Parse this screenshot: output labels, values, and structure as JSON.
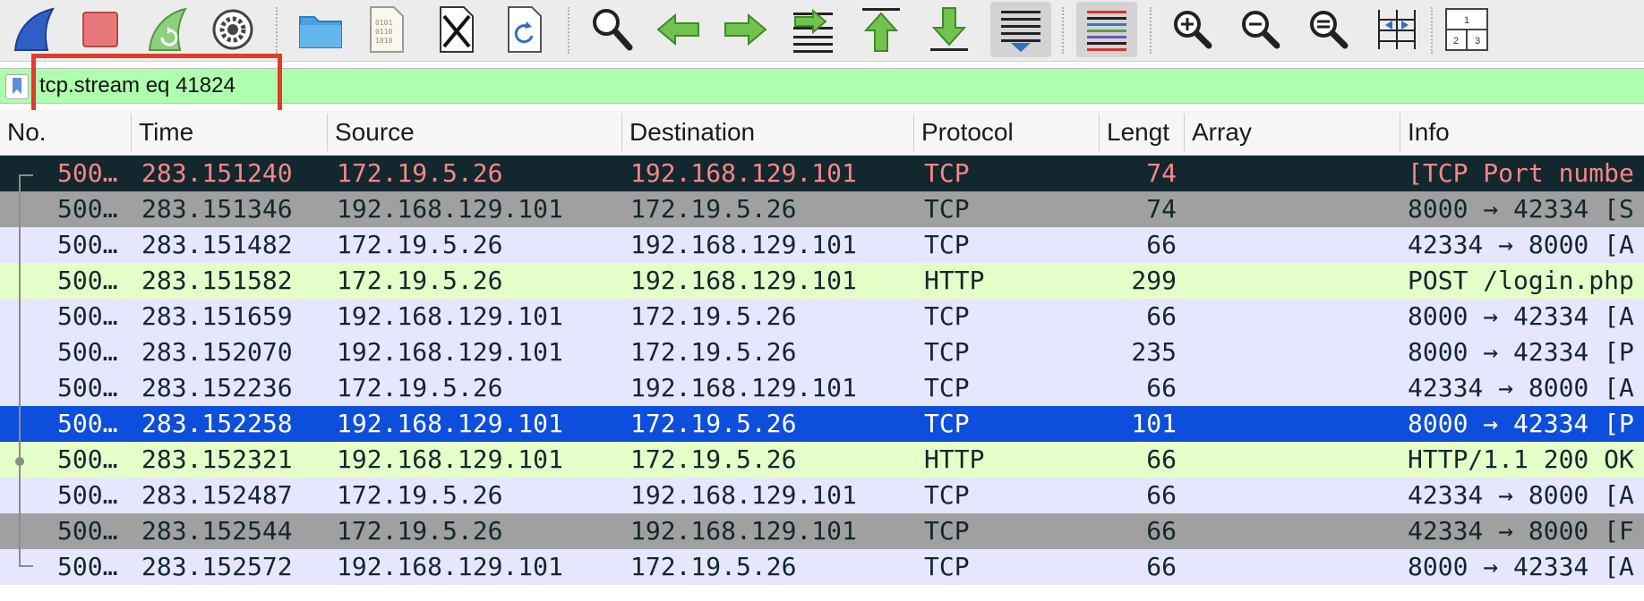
{
  "toolbar": {
    "buttons": [
      {
        "name": "start-capture-button",
        "icon": "shark-fin-icon"
      },
      {
        "name": "stop-capture-button",
        "icon": "stop-square-icon"
      },
      {
        "name": "restart-capture-button",
        "icon": "restart-fin-icon"
      },
      {
        "name": "capture-options-button",
        "icon": "gear-icon"
      },
      {
        "name": "open-file-button",
        "icon": "folder-icon"
      },
      {
        "name": "save-file-button",
        "icon": "binary-file-icon"
      },
      {
        "name": "close-file-button",
        "icon": "close-file-icon"
      },
      {
        "name": "reload-file-button",
        "icon": "reload-file-icon"
      },
      {
        "name": "find-packet-button",
        "icon": "magnifier-icon"
      },
      {
        "name": "go-back-button",
        "icon": "arrow-left-icon"
      },
      {
        "name": "go-forward-button",
        "icon": "arrow-right-icon"
      },
      {
        "name": "go-to-packet-button",
        "icon": "jump-arrow-icon"
      },
      {
        "name": "first-packet-button",
        "icon": "arrow-up-bar-icon"
      },
      {
        "name": "last-packet-button",
        "icon": "arrow-down-bar-icon"
      },
      {
        "name": "auto-scroll-button",
        "icon": "auto-scroll-icon"
      },
      {
        "name": "colorize-button",
        "icon": "color-lines-icon"
      },
      {
        "name": "zoom-in-button",
        "icon": "zoom-in-icon"
      },
      {
        "name": "zoom-out-button",
        "icon": "zoom-out-icon"
      },
      {
        "name": "normal-size-button",
        "icon": "zoom-reset-icon"
      },
      {
        "name": "resize-columns-button",
        "icon": "resize-columns-icon"
      },
      {
        "name": "layout-button",
        "icon": "layout-icon"
      }
    ],
    "layout_digits": [
      "1",
      "2",
      "3"
    ]
  },
  "filter": {
    "value": "tcp.stream eq 41824"
  },
  "columns": [
    "No.",
    "Time",
    "Source",
    "Destination",
    "Protocol",
    "Lengt",
    "Array",
    "Info"
  ],
  "packets": [
    {
      "no": "500…",
      "time": "283.151240",
      "source": "172.19.5.26",
      "destination": "192.168.129.101",
      "protocol": "TCP",
      "length": "74",
      "array": "",
      "info": "[TCP Port numbe",
      "style": "bad"
    },
    {
      "no": "500…",
      "time": "283.151346",
      "source": "192.168.129.101",
      "destination": "172.19.5.26",
      "protocol": "TCP",
      "length": "74",
      "array": "",
      "info": "8000 → 42334 [S",
      "style": "gray"
    },
    {
      "no": "500…",
      "time": "283.151482",
      "source": "172.19.5.26",
      "destination": "192.168.129.101",
      "protocol": "TCP",
      "length": "66",
      "array": "",
      "info": "42334 → 8000 [A",
      "style": "tcp"
    },
    {
      "no": "500…",
      "time": "283.151582",
      "source": "172.19.5.26",
      "destination": "192.168.129.101",
      "protocol": "HTTP",
      "length": "299",
      "array": "",
      "info": "POST /login.php",
      "style": "http"
    },
    {
      "no": "500…",
      "time": "283.151659",
      "source": "192.168.129.101",
      "destination": "172.19.5.26",
      "protocol": "TCP",
      "length": "66",
      "array": "",
      "info": "8000 → 42334 [A",
      "style": "tcp"
    },
    {
      "no": "500…",
      "time": "283.152070",
      "source": "192.168.129.101",
      "destination": "172.19.5.26",
      "protocol": "TCP",
      "length": "235",
      "array": "",
      "info": "8000 → 42334 [P",
      "style": "tcp"
    },
    {
      "no": "500…",
      "time": "283.152236",
      "source": "172.19.5.26",
      "destination": "192.168.129.101",
      "protocol": "TCP",
      "length": "66",
      "array": "",
      "info": "42334 → 8000 [A",
      "style": "tcp"
    },
    {
      "no": "500…",
      "time": "283.152258",
      "source": "192.168.129.101",
      "destination": "172.19.5.26",
      "protocol": "TCP",
      "length": "101",
      "array": "",
      "info": "8000 → 42334 [P",
      "style": "selected"
    },
    {
      "no": "500…",
      "time": "283.152321",
      "source": "192.168.129.101",
      "destination": "172.19.5.26",
      "protocol": "HTTP",
      "length": "66",
      "array": "",
      "info": "HTTP/1.1 200 OK",
      "style": "http"
    },
    {
      "no": "500…",
      "time": "283.152487",
      "source": "172.19.5.26",
      "destination": "192.168.129.101",
      "protocol": "TCP",
      "length": "66",
      "array": "",
      "info": "42334 → 8000 [A",
      "style": "tcp"
    },
    {
      "no": "500…",
      "time": "283.152544",
      "source": "172.19.5.26",
      "destination": "192.168.129.101",
      "protocol": "TCP",
      "length": "66",
      "array": "",
      "info": "42334 → 8000 [F",
      "style": "gray"
    },
    {
      "no": "500…",
      "time": "283.152572",
      "source": "192.168.129.101",
      "destination": "172.19.5.26",
      "protocol": "TCP",
      "length": "66",
      "array": "",
      "info": "8000 → 42334 [A",
      "style": "tcp"
    }
  ],
  "colors": {
    "filter_bg": "#afffaf",
    "tcp_row": "#e7e6ff",
    "http_row": "#e4ffc7",
    "gray_row": "#a0a0a0",
    "bad_row_bg": "#12272e",
    "bad_row_fg": "#f78787",
    "selected_row": "#0d4fdc",
    "highlight_box": "#e23b27"
  }
}
